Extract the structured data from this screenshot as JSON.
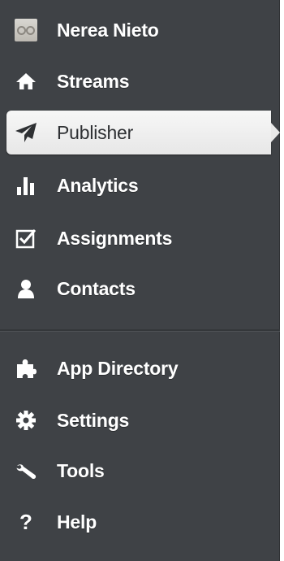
{
  "sidebar": {
    "profile": {
      "name": "Nerea Nieto",
      "icon": "avatar"
    },
    "items": [
      {
        "label": "Streams",
        "icon": "home-icon"
      },
      {
        "label": "Publisher",
        "icon": "paper-plane-icon",
        "active": true
      },
      {
        "label": "Analytics",
        "icon": "bar-chart-icon"
      },
      {
        "label": "Assignments",
        "icon": "checkbox-icon"
      },
      {
        "label": "Contacts",
        "icon": "person-icon"
      }
    ],
    "secondary_items": [
      {
        "label": "App Directory",
        "icon": "puzzle-icon"
      },
      {
        "label": "Settings",
        "icon": "gear-icon"
      },
      {
        "label": "Tools",
        "icon": "wrench-icon"
      },
      {
        "label": "Help",
        "icon": "help-icon",
        "glyph": "?"
      }
    ]
  },
  "colors": {
    "sidebar_bg": "#3f4246",
    "active_bg": "#f0f0f0",
    "text": "#ffffff",
    "active_text": "#2e3033"
  }
}
